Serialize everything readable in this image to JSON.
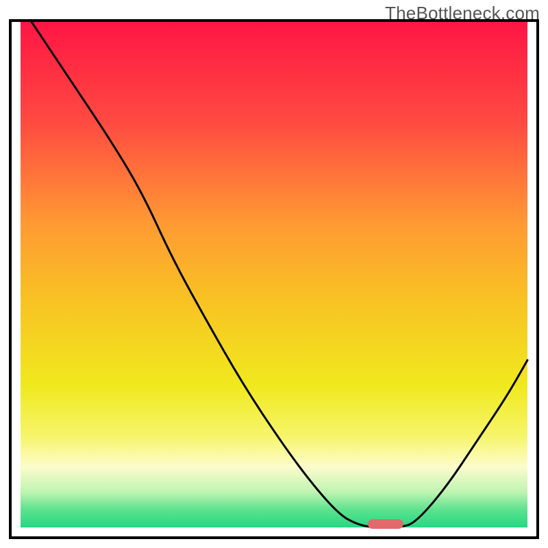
{
  "watermark": "TheBottleneck.com",
  "chart_data": {
    "type": "line",
    "title": "",
    "xlabel": "",
    "ylabel": "",
    "xlim": [
      0,
      100
    ],
    "ylim": [
      0,
      100
    ],
    "grid": false,
    "legend": false,
    "background": {
      "kind": "vertical-gradient",
      "stops": [
        {
          "pos": 0.0,
          "color": "#ff1544"
        },
        {
          "pos": 0.2,
          "color": "#ff4a41"
        },
        {
          "pos": 0.4,
          "color": "#ff9a33"
        },
        {
          "pos": 0.55,
          "color": "#f8c223"
        },
        {
          "pos": 0.72,
          "color": "#f0e91e"
        },
        {
          "pos": 0.82,
          "color": "#f6f56a"
        },
        {
          "pos": 0.88,
          "color": "#fdfccc"
        },
        {
          "pos": 0.93,
          "color": "#bff4b2"
        },
        {
          "pos": 0.965,
          "color": "#5de28e"
        },
        {
          "pos": 1.0,
          "color": "#24d884"
        }
      ]
    },
    "accent_marker": {
      "shape": "rounded-bar",
      "x_center": 72,
      "y": 0,
      "width": 7,
      "color": "#e26a6a"
    },
    "series": [
      {
        "name": "curve",
        "color": "#000000",
        "points": [
          {
            "x": 2,
            "y": 100
          },
          {
            "x": 10,
            "y": 88
          },
          {
            "x": 18,
            "y": 76
          },
          {
            "x": 24,
            "y": 66
          },
          {
            "x": 30,
            "y": 53
          },
          {
            "x": 36,
            "y": 42
          },
          {
            "x": 44,
            "y": 28
          },
          {
            "x": 52,
            "y": 16
          },
          {
            "x": 58,
            "y": 8
          },
          {
            "x": 63,
            "y": 2.5
          },
          {
            "x": 66,
            "y": 0.8
          },
          {
            "x": 69,
            "y": 0
          },
          {
            "x": 75,
            "y": 0
          },
          {
            "x": 78,
            "y": 1
          },
          {
            "x": 84,
            "y": 8
          },
          {
            "x": 90,
            "y": 17
          },
          {
            "x": 96,
            "y": 26
          },
          {
            "x": 100,
            "y": 33
          }
        ]
      }
    ]
  }
}
